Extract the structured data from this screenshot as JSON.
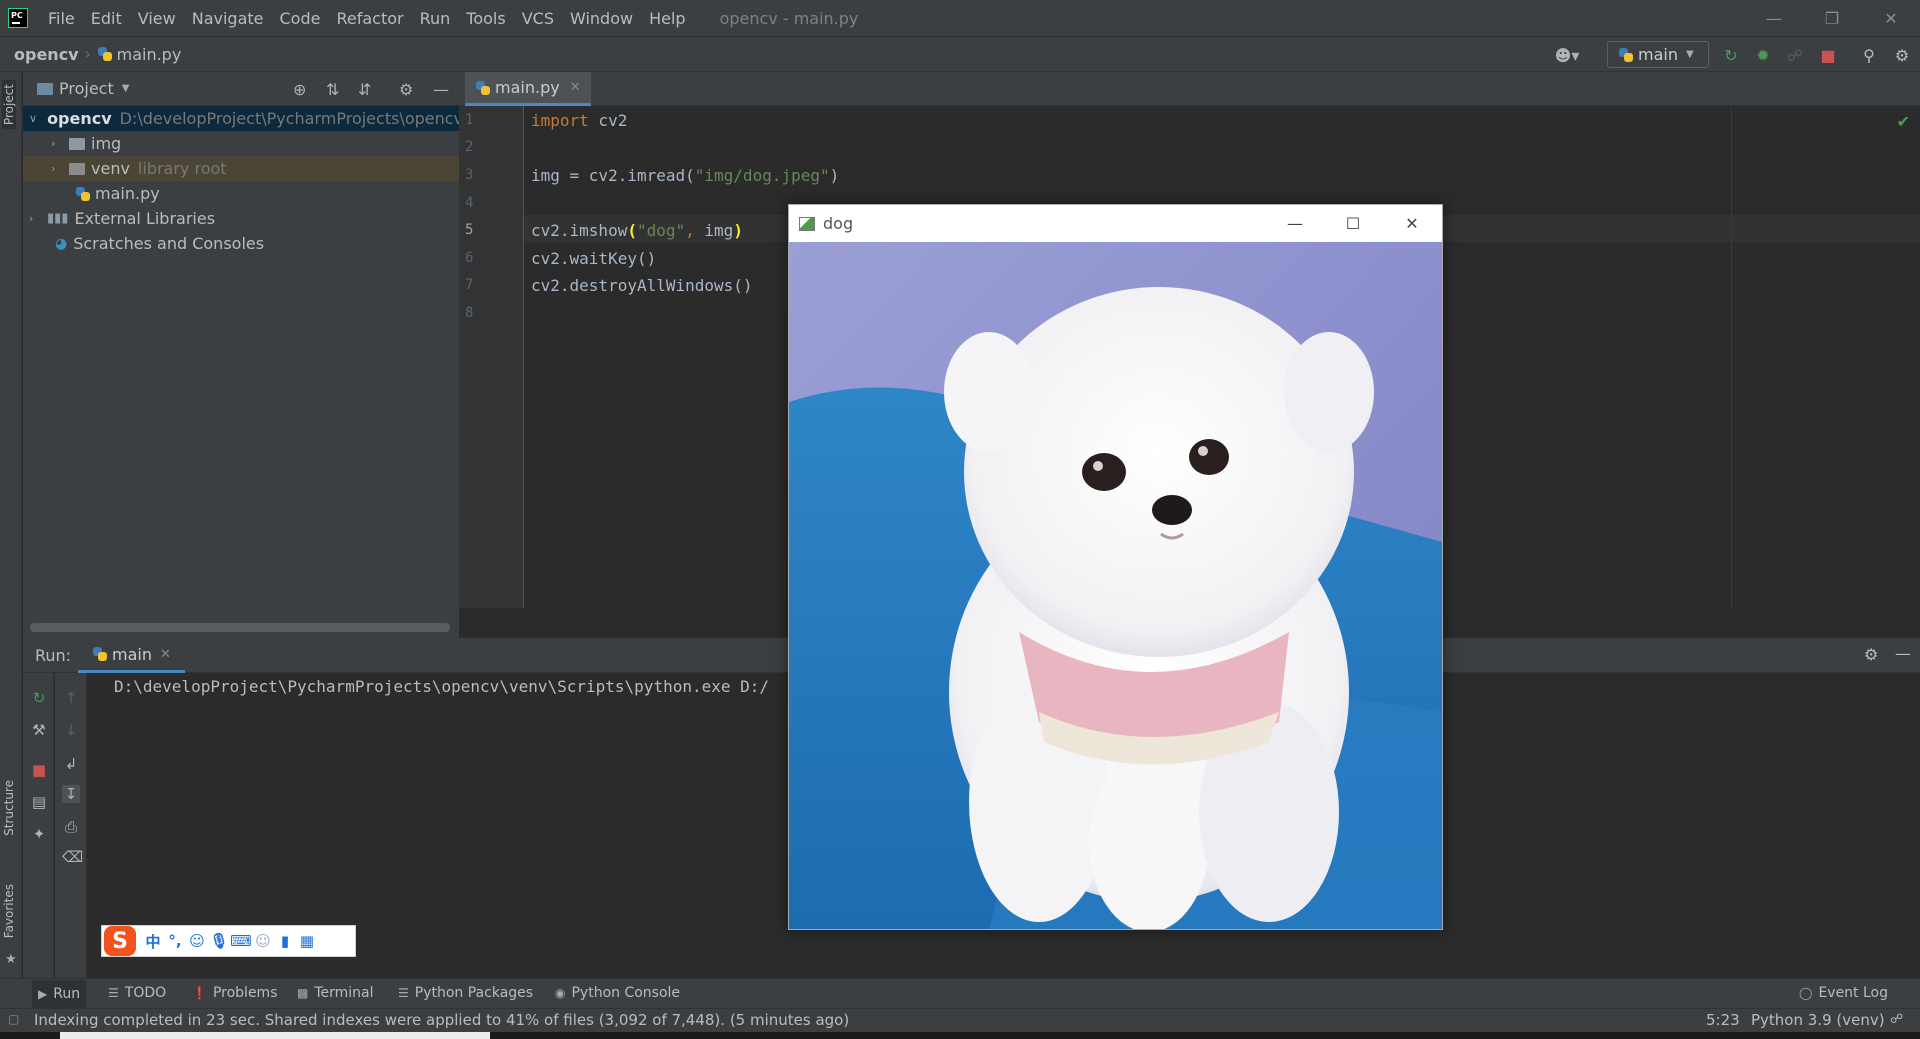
{
  "menubar": {
    "items": [
      "File",
      "Edit",
      "View",
      "Navigate",
      "Code",
      "Refactor",
      "Run",
      "Tools",
      "VCS",
      "Window",
      "Help"
    ],
    "window_title": "opencv - main.py"
  },
  "navbar": {
    "project": "opencv",
    "file": "main.py",
    "run_config": "main"
  },
  "left_stripe": {
    "project_tab": "Project",
    "structure_tab": "Structure",
    "favorites_tab": "Favorites"
  },
  "project_panel": {
    "title": "Project",
    "tree": {
      "root_name": "opencv",
      "root_path": "D:\\developProject\\PycharmProjects\\opencv",
      "img": "img",
      "venv": "venv",
      "venv_note": "library root",
      "main_file": "main.py",
      "external": "External Libraries",
      "scratches": "Scratches and Consoles"
    }
  },
  "editor": {
    "tab": "main.py",
    "line_numbers": [
      "1",
      "2",
      "3",
      "4",
      "5",
      "6",
      "7",
      "8"
    ],
    "code": {
      "l1_kw": "import",
      "l1_rest": " cv2",
      "l3_a": "img = cv2.imread(",
      "l3_str": "\"img/dog.jpeg\"",
      "l3_b": ")",
      "l5_a": "cv2.imshow",
      "l5_paren_open": "(",
      "l5_str": "\"dog\"",
      "l5_comma": ", ",
      "l5_b": "img",
      "l5_paren_close": ")",
      "l6": "cv2.waitKey()",
      "l7": "cv2.destroyAllWindows()"
    }
  },
  "run_panel": {
    "title": "Run:",
    "tab": "main",
    "console": "D:\\developProject\\PycharmProjects\\opencv\\venv\\Scripts\\python.exe D:/"
  },
  "ime": {
    "logo": "S",
    "mode": "中",
    "punct": "°,"
  },
  "tool_windows": [
    "Run",
    "TODO",
    "Problems",
    "Terminal",
    "Python Packages",
    "Python Console"
  ],
  "event_log": "Event Log",
  "status": {
    "message": "Indexing completed in 23 sec. Shared indexes were applied to 41% of files (3,092 of 7,448). (5 minutes ago)",
    "position": "5:23",
    "interpreter": "Python 3.9 (venv)"
  },
  "image_window": {
    "title": "dog"
  },
  "colors": {
    "accent": "#4a88c7",
    "keyword": "#cc7832",
    "string": "#6a8759",
    "stop_red": "#c75450",
    "run_green": "#499c54"
  }
}
